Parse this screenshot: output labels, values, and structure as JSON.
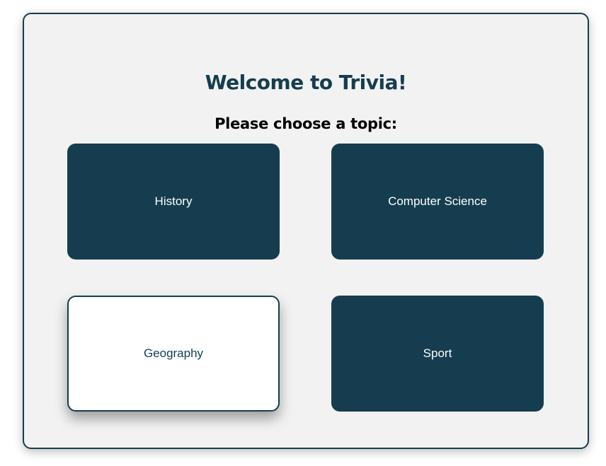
{
  "title": "Welcome to Trivia!",
  "subtitle": "Please choose a topic:",
  "topics": [
    {
      "label": "History"
    },
    {
      "label": "Computer Science"
    },
    {
      "label": "Geography"
    },
    {
      "label": "Sport"
    }
  ],
  "colors": {
    "primary": "#153d4f",
    "background": "#f2f2f2",
    "hover_background": "#ffffff"
  }
}
